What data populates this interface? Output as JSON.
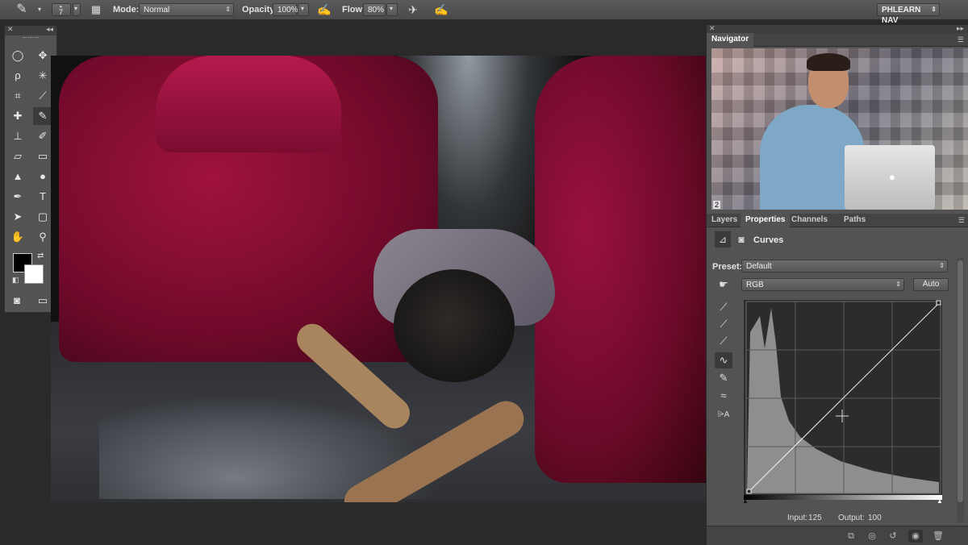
{
  "options_bar": {
    "brush_size": "7",
    "mode_label": "Mode:",
    "mode_value": "Normal",
    "opacity_label": "Opacity:",
    "opacity_value": "100%",
    "flow_label": "Flow:",
    "flow_value": "80%",
    "workspace": "PHLEARN NAV"
  },
  "tools": {
    "items": [
      {
        "name": "elliptical-marquee-tool",
        "glyph": "◯"
      },
      {
        "name": "move-tool",
        "glyph": "✥"
      },
      {
        "name": "lasso-tool",
        "glyph": "ρ"
      },
      {
        "name": "magic-wand-tool",
        "glyph": "✳"
      },
      {
        "name": "crop-tool",
        "glyph": "⌗"
      },
      {
        "name": "eyedropper-tool",
        "glyph": "⟋"
      },
      {
        "name": "healing-brush-tool",
        "glyph": "✚"
      },
      {
        "name": "brush-tool",
        "glyph": "✎"
      },
      {
        "name": "clone-stamp-tool",
        "glyph": "⊥"
      },
      {
        "name": "history-brush-tool",
        "glyph": "✐"
      },
      {
        "name": "eraser-tool",
        "glyph": "▱"
      },
      {
        "name": "gradient-tool",
        "glyph": "▭"
      },
      {
        "name": "blur-tool",
        "glyph": "▲"
      },
      {
        "name": "dodge-tool",
        "glyph": "●"
      },
      {
        "name": "pen-tool",
        "glyph": "✒"
      },
      {
        "name": "type-tool",
        "glyph": "T"
      },
      {
        "name": "path-selection-tool",
        "glyph": "➤"
      },
      {
        "name": "rectangle-tool",
        "glyph": "▢"
      },
      {
        "name": "hand-tool",
        "glyph": "✋"
      },
      {
        "name": "zoom-tool",
        "glyph": "⚲"
      }
    ],
    "foreground_color": "#000000",
    "background_color": "#ffffff"
  },
  "navigator": {
    "tab": "Navigator",
    "zoom": "2"
  },
  "panel_tabs": [
    "Layers",
    "Properties",
    "Channels",
    "Paths"
  ],
  "properties": {
    "title": "Curves",
    "preset_label": "Preset:",
    "preset_value": "Default",
    "channel_value": "RGB",
    "auto_label": "Auto",
    "input_label": "Input:",
    "input_value": "125",
    "output_label": "Output:",
    "output_value": "100"
  },
  "colors": {
    "panel_bg": "#535353",
    "chair_red": "#8e0f3a"
  }
}
